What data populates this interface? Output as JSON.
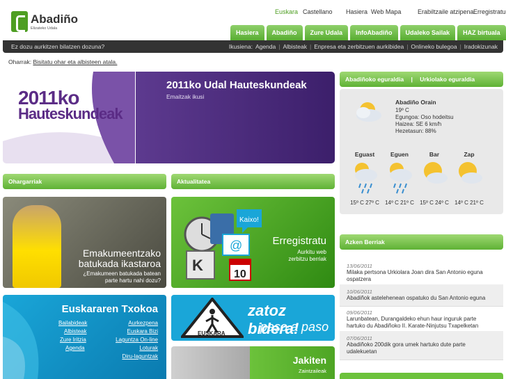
{
  "header": {
    "logo_name": "Abadiño",
    "logo_sub": "Elizateko Udala",
    "lang_eu": "Euskara",
    "lang_es": "Castellano",
    "home": "Hasiera",
    "webmap": "Web Mapa",
    "user_login": "Erabiltzaile atzipena",
    "register": "Erregistratu",
    "tabs": [
      "Hasiera",
      "Abadiño",
      "Zure Udala",
      "InfoAbadiño",
      "Udaleko Sailak",
      "HAZ birtuala"
    ]
  },
  "navbar": {
    "question": "Ez dozu aurkitzen bilatzen dozuna?",
    "links_label": "Ikusiena:",
    "links": [
      "Agenda",
      "Albisteak",
      "Enpresa eta zerbitzuen aurkibidea",
      "Onlineko bulegoa",
      "Iradokizunak"
    ]
  },
  "notice": {
    "label": "Oharrak:",
    "link": "Bisitatu ohar eta albisteen atala."
  },
  "banner": {
    "year": "2011ko",
    "word": "Hauteskundeak",
    "title": "2011ko Udal Hauteskundeak",
    "sub": "Emaitzak ikusi"
  },
  "sections": {
    "ohargarriak": "Ohargarriak",
    "aktualitatea": "Aktualitatea",
    "azken_berriak": "Azken Berriak"
  },
  "tiles": {
    "emak_t1": "Emakumeentzako",
    "emak_t2": "batukada ikastaroa",
    "emak_sub": "¿Emakumeen batukada batean parte hartu nahi dozu?",
    "erreg_bubble": "Kaixo!",
    "erreg_date": "10",
    "erreg_title": "Erregistratu",
    "erreg_sub1": "Aurkitu web",
    "erreg_sub2": "zerbitzu berriak",
    "eusk_title": "Euskararen Txokoa",
    "eusk_links_left": [
      "Bailabideak",
      "Albisteak",
      "Zure Iritzia",
      "Agenda"
    ],
    "eusk_links_right": [
      "Aurkezpena",
      "Euskara Bizi",
      "Laguntza On-line",
      "Loturak",
      "Diru-laguntzak"
    ],
    "zatoz_1": "zatoz bidera!",
    "zatoz_2": "paso a paso",
    "zatoz_sign": "EUSKARA",
    "jak_title": "Jakiten",
    "jak_sub": "Zaintzaileak"
  },
  "weather": {
    "tab_today": "Abadiñoko eguraldia",
    "tab_urk": "Urkiolako eguraldia",
    "now_title": "Abadiño Orain",
    "temp": "19º C",
    "sky": "Egungoa: Oso hodeitsu",
    "wind": "Haizea: SE 6 km/h",
    "humidity": "Hezetasun: 88%",
    "days": [
      {
        "name": "Eguast",
        "temps": "15º C 27º C",
        "icon": "rain-icon"
      },
      {
        "name": "Eguen",
        "temps": "14º C 21º C",
        "icon": "rain-icon"
      },
      {
        "name": "Bar",
        "temps": "15º C 24º C",
        "icon": "sun-cloud-icon"
      },
      {
        "name": "Zap",
        "temps": "14º C 21º C",
        "icon": "sun-cloud-icon"
      }
    ]
  },
  "news": [
    {
      "date": "13/06/2011",
      "text": "Milaka pertsona Urkiolara Joan dira San Antonio eguna ospatzera"
    },
    {
      "date": "10/06/2011",
      "text": "Abadiñok astelehenean ospatuko du San Antonio eguna"
    },
    {
      "date": "09/06/2011",
      "text": "Larunbatean, Durangaldeko ehun haur inguruk parte hartuko du Abadiñoko II. Karate-Ninjutsu Txapelketan"
    },
    {
      "date": "07/06/2011",
      "text": "Abadiñoko 200dik gora umek hartuko dute parte udalekuetan"
    }
  ],
  "colors": {
    "green": "#5fb235",
    "purple": "#5b2c86",
    "blue": "#1aa6d8",
    "dark": "#333333"
  }
}
